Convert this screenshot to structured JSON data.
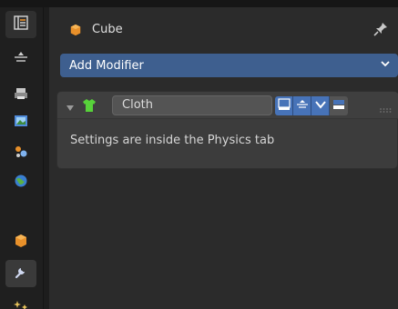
{
  "header": {
    "object_name": "Cube"
  },
  "add_modifier": {
    "label": "Add Modifier"
  },
  "modifier": {
    "name": "Cloth",
    "message": "Settings are inside the Physics tab"
  },
  "tabs": [
    {
      "icon": "tool-settings-icon",
      "state": "normal"
    },
    {
      "icon": "render-properties-icon",
      "state": "normal"
    },
    {
      "icon": "output-properties-icon",
      "state": "normal"
    },
    {
      "icon": "view-layer-icon",
      "state": "normal"
    },
    {
      "icon": "scene-properties-icon",
      "state": "normal"
    },
    {
      "icon": "world-properties-icon",
      "state": "normal"
    },
    {
      "icon": "object-properties-icon",
      "state": "normal"
    },
    {
      "icon": "modifier-properties-icon",
      "state": "active"
    },
    {
      "icon": "particles-icon",
      "state": "normal"
    }
  ],
  "colors": {
    "accent_blue": "#4773b8",
    "add_modifier_bg": "#3e5f8f",
    "object_orange": "#e8902a",
    "cloth_green": "#57d23a"
  }
}
